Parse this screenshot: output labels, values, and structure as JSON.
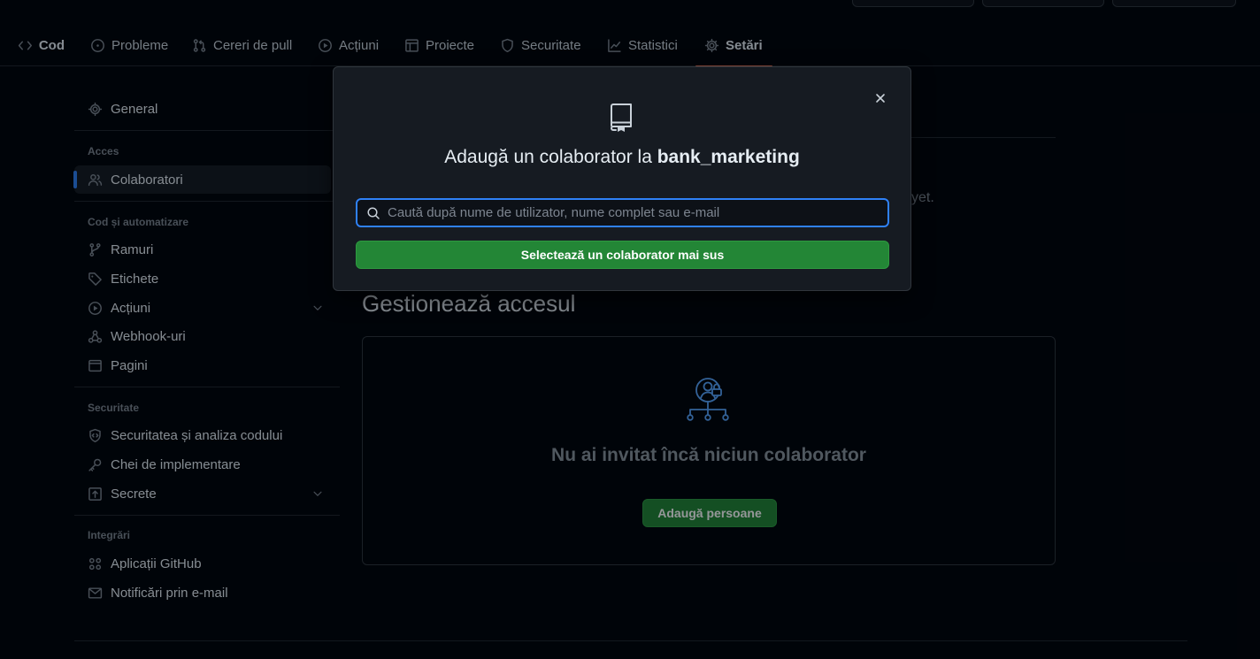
{
  "nav": {
    "tabs": [
      {
        "label": "Cod",
        "icon": "code-icon"
      },
      {
        "label": "Probleme",
        "icon": "issue-icon"
      },
      {
        "label": "Cereri de pull",
        "icon": "pull-request-icon"
      },
      {
        "label": "Acțiuni",
        "icon": "play-icon"
      },
      {
        "label": "Proiecte",
        "icon": "table-icon"
      },
      {
        "label": "Securitate",
        "icon": "shield-icon"
      },
      {
        "label": "Statistici",
        "icon": "graph-icon"
      },
      {
        "label": "Setări",
        "icon": "gear-icon"
      }
    ],
    "active_tab": "Setări"
  },
  "sidebar": {
    "general": "General",
    "sections": [
      {
        "heading": "Acces",
        "items": [
          "Colaboratori"
        ]
      },
      {
        "heading": "Cod și automatizare",
        "items": [
          "Ramuri",
          "Etichete",
          "Acțiuni",
          "Webhook-uri",
          "Pagini"
        ]
      },
      {
        "heading": "Securitate",
        "items": [
          "Securitatea și analiza codului",
          "Chei de implementare",
          "Secrete"
        ]
      },
      {
        "heading": "Integrări",
        "items": [
          "Aplicații GitHub",
          "Notificări prin e-mail"
        ]
      }
    ],
    "selected": "Colaboratori"
  },
  "main": {
    "partial_text": "yet.",
    "section_title": "Gestionează accesul",
    "empty_state_title": "Nu ai invitat încă niciun colaborator",
    "add_people_label": "Adaugă persoane"
  },
  "dialog": {
    "title_prefix": "Adaugă un colaborator la",
    "repo_name": "bank_marketing",
    "search_placeholder": "Caută după nume de utilizator, nume complet sau e-mail",
    "search_value": "",
    "select_button_label": "Selectează un colaborator mai sus"
  },
  "colors": {
    "background": "#010409",
    "dialog_bg": "#161b22",
    "accent_green": "#238636",
    "focus_blue": "#2f81f7",
    "active_tab_underline": "#f78166"
  }
}
